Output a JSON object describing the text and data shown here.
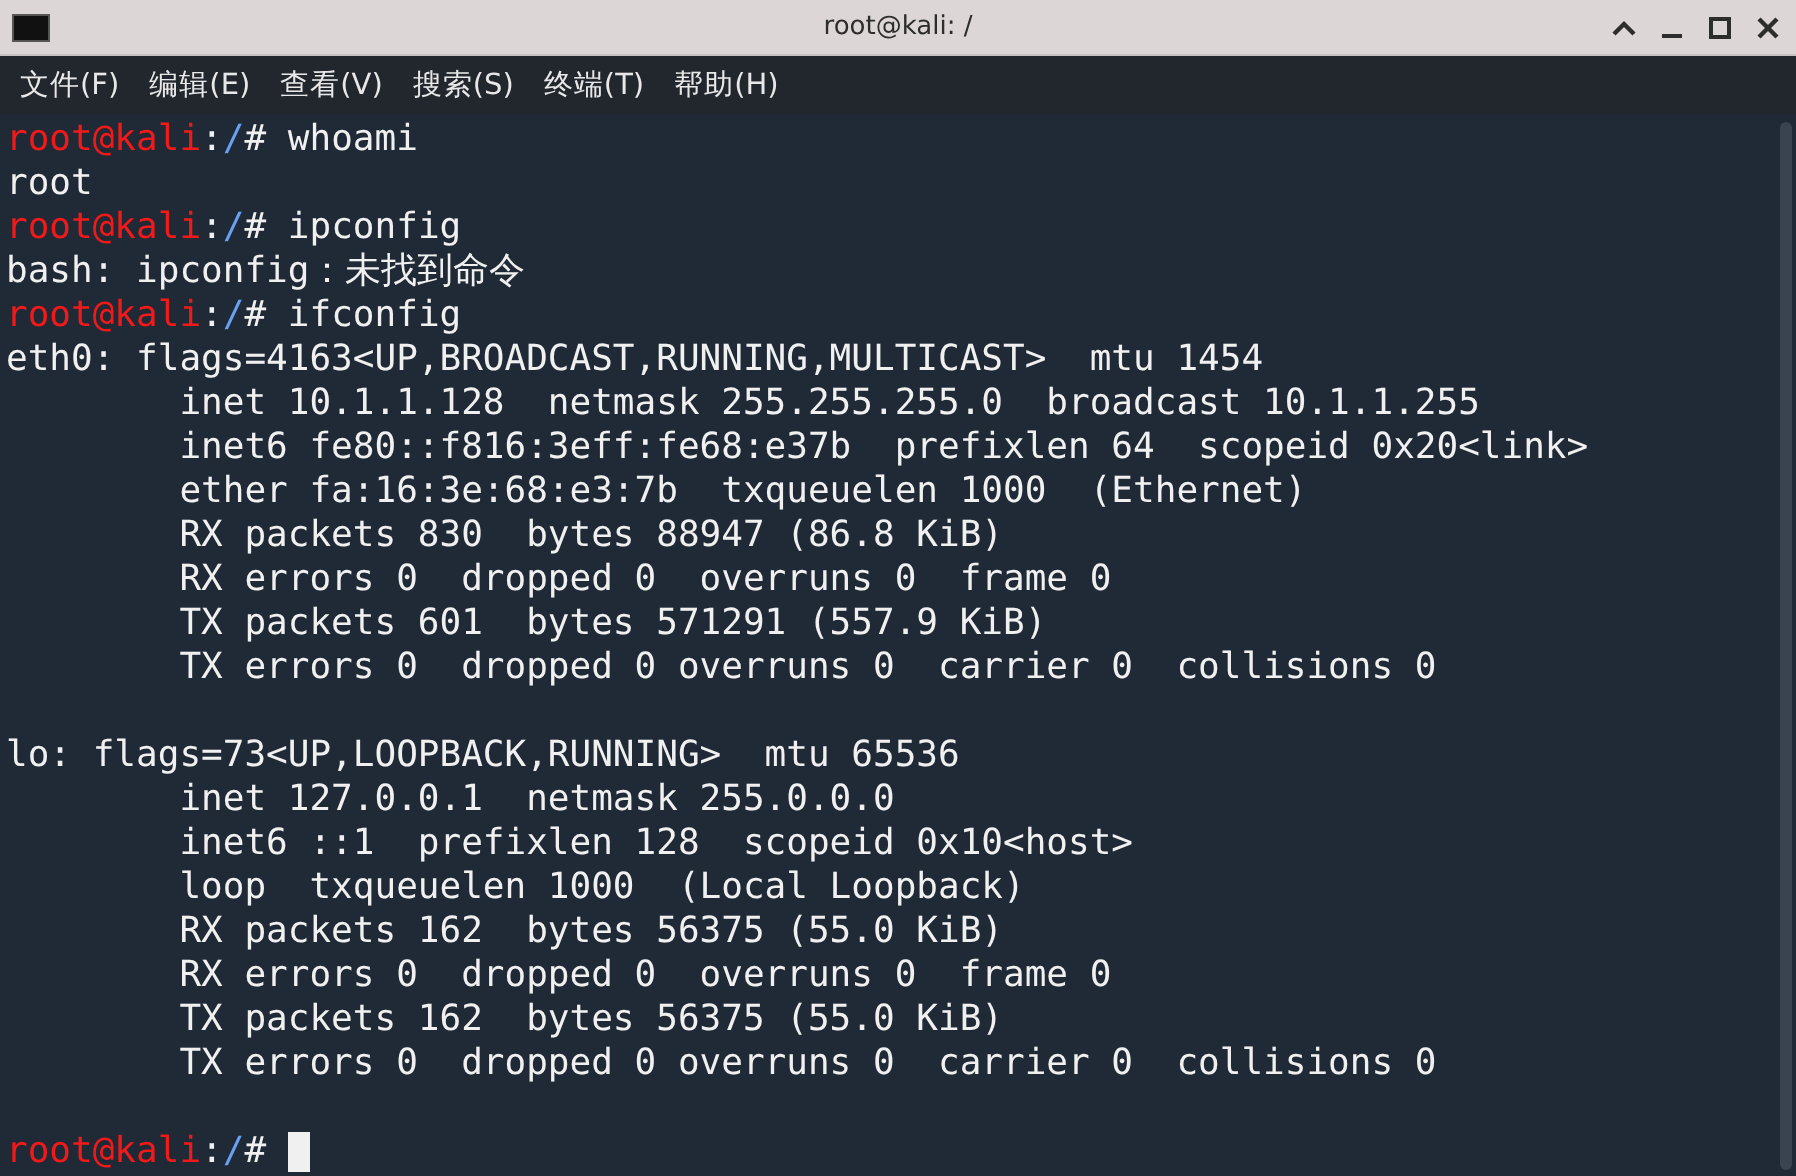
{
  "window": {
    "title": "root@kali: /"
  },
  "menu": [
    "文件(F)",
    "编辑(E)",
    "查看(V)",
    "搜索(S)",
    "终端(T)",
    "帮助(H)"
  ],
  "terminal": {
    "lines": [
      {
        "kind": "prompt",
        "user_host": "root@kali",
        "separator": ":",
        "path": "/",
        "symbol": "# ",
        "command": "whoami"
      },
      {
        "kind": "output",
        "text": "root"
      },
      {
        "kind": "prompt",
        "user_host": "root@kali",
        "separator": ":",
        "path": "/",
        "symbol": "# ",
        "command": "ipconfig"
      },
      {
        "kind": "output",
        "text": "bash: ipconfig：未找到命令"
      },
      {
        "kind": "prompt",
        "user_host": "root@kali",
        "separator": ":",
        "path": "/",
        "symbol": "# ",
        "command": "ifconfig"
      },
      {
        "kind": "output",
        "text": "eth0: flags=4163<UP,BROADCAST,RUNNING,MULTICAST>  mtu 1454"
      },
      {
        "kind": "output",
        "text": "        inet 10.1.1.128  netmask 255.255.255.0  broadcast 10.1.1.255"
      },
      {
        "kind": "output",
        "text": "        inet6 fe80::f816:3eff:fe68:e37b  prefixlen 64  scopeid 0x20<link>"
      },
      {
        "kind": "output",
        "text": "        ether fa:16:3e:68:e3:7b  txqueuelen 1000  (Ethernet)"
      },
      {
        "kind": "output",
        "text": "        RX packets 830  bytes 88947 (86.8 KiB)"
      },
      {
        "kind": "output",
        "text": "        RX errors 0  dropped 0  overruns 0  frame 0"
      },
      {
        "kind": "output",
        "text": "        TX packets 601  bytes 571291 (557.9 KiB)"
      },
      {
        "kind": "output",
        "text": "        TX errors 0  dropped 0 overruns 0  carrier 0  collisions 0"
      },
      {
        "kind": "blank"
      },
      {
        "kind": "output",
        "text": "lo: flags=73<UP,LOOPBACK,RUNNING>  mtu 65536"
      },
      {
        "kind": "output",
        "text": "        inet 127.0.0.1  netmask 255.0.0.0"
      },
      {
        "kind": "output",
        "text": "        inet6 ::1  prefixlen 128  scopeid 0x10<host>"
      },
      {
        "kind": "output",
        "text": "        loop  txqueuelen 1000  (Local Loopback)"
      },
      {
        "kind": "output",
        "text": "        RX packets 162  bytes 56375 (55.0 KiB)"
      },
      {
        "kind": "output",
        "text": "        RX errors 0  dropped 0  overruns 0  frame 0"
      },
      {
        "kind": "output",
        "text": "        TX packets 162  bytes 56375 (55.0 KiB)"
      },
      {
        "kind": "output",
        "text": "        TX errors 0  dropped 0 overruns 0  carrier 0  collisions 0"
      },
      {
        "kind": "blank"
      },
      {
        "kind": "prompt",
        "user_host": "root@kali",
        "separator": ":",
        "path": "/",
        "symbol": "# ",
        "cursor": true
      }
    ]
  }
}
